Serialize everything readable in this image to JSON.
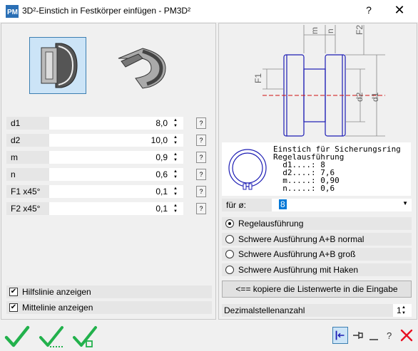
{
  "window": {
    "title": "3D²-Einstich in Festkörper einfügen   -   PM3D²",
    "help_label": "?",
    "close_label": "✕"
  },
  "params": [
    {
      "label": "d1",
      "value": "8,0"
    },
    {
      "label": "d2",
      "value": "10,0"
    },
    {
      "label": "m",
      "value": "0,9"
    },
    {
      "label": "n",
      "value": "0,6"
    },
    {
      "label": "F1 x45°",
      "value": "0,1"
    },
    {
      "label": "F2 x45°",
      "value": "0,1"
    }
  ],
  "info_label": "?",
  "checkboxes": {
    "hilfslinie": {
      "label": "Hilfslinie anzeigen",
      "checked": true
    },
    "mittellinie": {
      "label": "Mittelinie anzeigen",
      "checked": true
    }
  },
  "drawing_labels": {
    "m": "m",
    "n": "n",
    "F2": "F2",
    "F1": "F1",
    "d2": "d2",
    "d1": "d1"
  },
  "ring_info": {
    "line1": "Einstich für Sicherungsring",
    "line2": "Regelausführung",
    "line3": "  d1....: 8",
    "line4": "  d2....: 7,6",
    "line5": "  m.....: 0,90",
    "line6": "  n.....: 0,6"
  },
  "fuer": {
    "label": "für ø:",
    "value": "8"
  },
  "radios": [
    {
      "label": "Regelausführung",
      "selected": true
    },
    {
      "label": "Schwere Ausführung A+B normal",
      "selected": false
    },
    {
      "label": "Schwere Ausführung A+B groß",
      "selected": false
    },
    {
      "label": "Schwere Ausführung mit Haken",
      "selected": false
    }
  ],
  "copy_button": "<== kopiere die Listenwerte in die Eingabe",
  "decimal": {
    "label": "Dezimalstellenanzahl",
    "value": "1"
  },
  "colors": {
    "accent": "#0078d7",
    "ok_green": "#22b14c",
    "close_red": "#e81123",
    "drawing_blue": "#1c1cb4"
  }
}
